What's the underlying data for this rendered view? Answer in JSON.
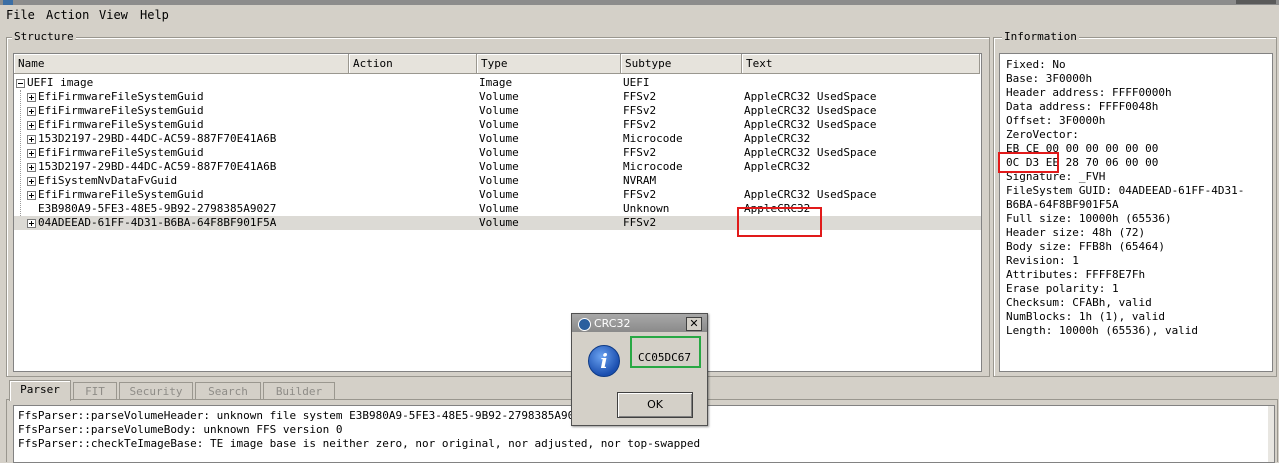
{
  "menu": [
    "File",
    "Action",
    "View",
    "Help"
  ],
  "structure": {
    "title": "Structure",
    "columns": [
      "Name",
      "Action",
      "Type",
      "Subtype",
      "Text"
    ],
    "rows": [
      {
        "name": "UEFI image",
        "action": "",
        "type": "Image",
        "subtype": "UEFI",
        "text": "",
        "expander": "minus",
        "level": 0
      },
      {
        "name": "EfiFirmwareFileSystemGuid",
        "action": "",
        "type": "Volume",
        "subtype": "FFSv2",
        "text": "AppleCRC32 UsedSpace",
        "expander": "plus",
        "level": 1
      },
      {
        "name": "EfiFirmwareFileSystemGuid",
        "action": "",
        "type": "Volume",
        "subtype": "FFSv2",
        "text": "AppleCRC32 UsedSpace",
        "expander": "plus",
        "level": 1
      },
      {
        "name": "EfiFirmwareFileSystemGuid",
        "action": "",
        "type": "Volume",
        "subtype": "FFSv2",
        "text": "AppleCRC32 UsedSpace",
        "expander": "plus",
        "level": 1
      },
      {
        "name": "153D2197-29BD-44DC-AC59-887F70E41A6B",
        "action": "",
        "type": "Volume",
        "subtype": "Microcode",
        "text": "AppleCRC32",
        "expander": "plus",
        "level": 1
      },
      {
        "name": "EfiFirmwareFileSystemGuid",
        "action": "",
        "type": "Volume",
        "subtype": "FFSv2",
        "text": "AppleCRC32 UsedSpace",
        "expander": "plus",
        "level": 1
      },
      {
        "name": "153D2197-29BD-44DC-AC59-887F70E41A6B",
        "action": "",
        "type": "Volume",
        "subtype": "Microcode",
        "text": "AppleCRC32",
        "expander": "plus",
        "level": 1
      },
      {
        "name": "EfiSystemNvDataFvGuid",
        "action": "",
        "type": "Volume",
        "subtype": "NVRAM",
        "text": "",
        "expander": "plus",
        "level": 1
      },
      {
        "name": "EfiFirmwareFileSystemGuid",
        "action": "",
        "type": "Volume",
        "subtype": "FFSv2",
        "text": "AppleCRC32 UsedSpace",
        "expander": "plus",
        "level": 1
      },
      {
        "name": "E3B980A9-5FE3-48E5-9B92-2798385A9027",
        "action": "",
        "type": "Volume",
        "subtype": "Unknown",
        "text": "AppleCRC32",
        "expander": "none",
        "level": 1
      },
      {
        "name": "04ADEEAD-61FF-4D31-B6BA-64F8BF901F5A",
        "action": "",
        "type": "Volume",
        "subtype": "FFSv2",
        "text": "",
        "expander": "plus",
        "level": 1,
        "selected": true
      }
    ]
  },
  "information": {
    "title": "Information",
    "lines": [
      "Fixed: No",
      "Base: 3F0000h",
      "Header address: FFFF0000h",
      "Data address: FFFF0048h",
      "Offset: 3F0000h",
      "ZeroVector:",
      "EB CE 00 00 00 00 00 00",
      "0C D3 EE 28 70 06 00 00",
      "Signature: _FVH",
      "FileSystem GUID: 04ADEEAD-61FF-4D31-",
      "B6BA-64F8BF901F5A",
      "Full size: 10000h (65536)",
      "Header size: 48h (72)",
      "Body size: FFB8h (65464)",
      "Revision: 1",
      "Attributes: FFFF8E7Fh",
      "Erase polarity: 1",
      "Checksum: CFABh, valid",
      "NumBlocks: 1h (1), valid",
      "Length: 10000h (65536), valid"
    ]
  },
  "tabs": [
    {
      "label": "Parser",
      "active": true,
      "disabled": false
    },
    {
      "label": "FIT",
      "active": false,
      "disabled": true
    },
    {
      "label": "Security",
      "active": false,
      "disabled": true
    },
    {
      "label": "Search",
      "active": false,
      "disabled": true
    },
    {
      "label": "Builder",
      "active": false,
      "disabled": true
    }
  ],
  "messages": [
    "FfsParser::parseVolumeHeader: unknown file system E3B980A9-5FE3-48E5-9B92-2798385A9027",
    "FfsParser::parseVolumeBody: unknown FFS version 0",
    "FfsParser::checkTeImageBase: TE image base is neither zero, nor original, nor adjusted, nor top-swapped"
  ],
  "dialog": {
    "title": "CRC32",
    "value": "CC05DC67",
    "ok_label": "OK",
    "close_glyph": "✕",
    "icon_glyph": "i"
  },
  "colors": {
    "highlight_red": "#e11a1a",
    "highlight_green": "#28a844"
  }
}
